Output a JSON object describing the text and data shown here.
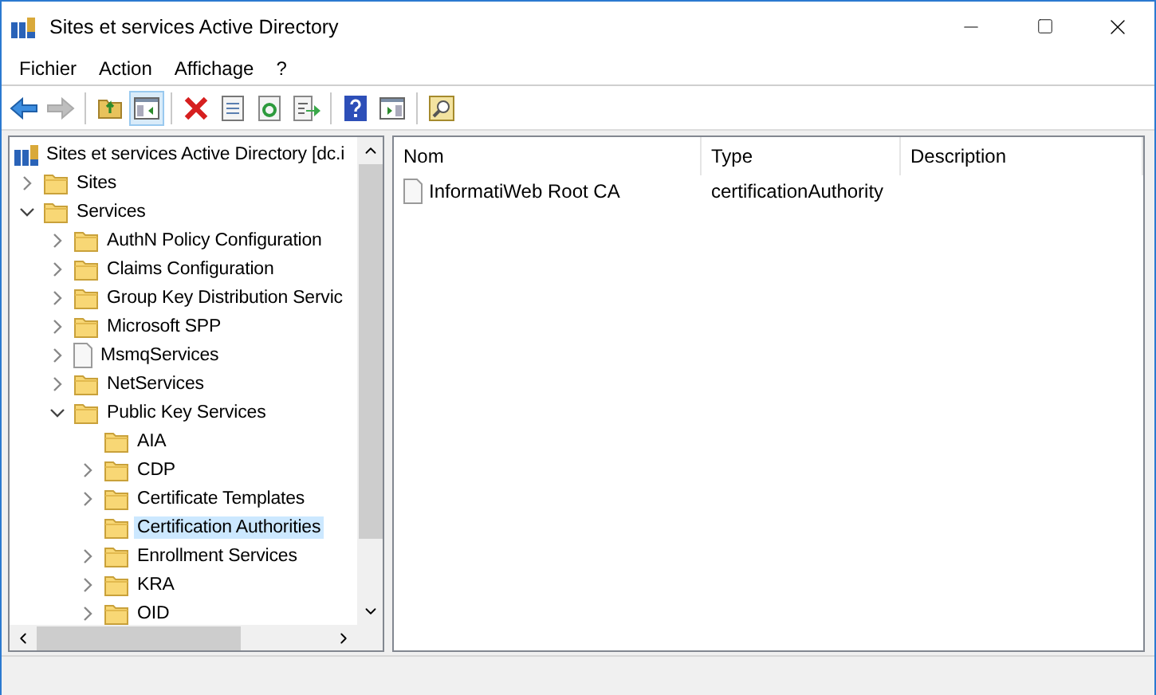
{
  "window": {
    "title": "Sites et services Active Directory"
  },
  "menu": [
    {
      "label": "Fichier"
    },
    {
      "label": "Action"
    },
    {
      "label": "Affichage"
    },
    {
      "label": "?"
    }
  ],
  "toolbar": [
    {
      "kind": "back",
      "disabled": false,
      "pressed": false
    },
    {
      "kind": "forward",
      "disabled": true,
      "pressed": false
    },
    {
      "kind": "separator"
    },
    {
      "kind": "up",
      "disabled": false,
      "pressed": false
    },
    {
      "kind": "console-tree",
      "disabled": false,
      "pressed": true
    },
    {
      "kind": "separator"
    },
    {
      "kind": "delete",
      "disabled": false,
      "pressed": false
    },
    {
      "kind": "properties",
      "disabled": false,
      "pressed": false
    },
    {
      "kind": "refresh",
      "disabled": false,
      "pressed": false
    },
    {
      "kind": "export",
      "disabled": false,
      "pressed": false
    },
    {
      "kind": "separator"
    },
    {
      "kind": "help",
      "disabled": false,
      "pressed": false
    },
    {
      "kind": "action-pane",
      "disabled": false,
      "pressed": false
    },
    {
      "kind": "separator"
    },
    {
      "kind": "find",
      "disabled": false,
      "pressed": false
    }
  ],
  "tree": {
    "root": {
      "label": "Sites et services Active Directory [dc.i",
      "selected": false
    },
    "items": [
      {
        "label": "Sites",
        "kind": "folder",
        "expandable": true,
        "expanded": false,
        "selected": false
      },
      {
        "label": "Services",
        "kind": "folder",
        "expandable": true,
        "expanded": true,
        "selected": false,
        "children": [
          {
            "label": "AuthN Policy Configuration",
            "kind": "folder",
            "expandable": true,
            "expanded": false,
            "selected": false
          },
          {
            "label": "Claims Configuration",
            "kind": "folder",
            "expandable": true,
            "expanded": false,
            "selected": false
          },
          {
            "label": "Group Key Distribution Servic",
            "kind": "folder",
            "expandable": true,
            "expanded": false,
            "selected": false
          },
          {
            "label": "Microsoft SPP",
            "kind": "folder",
            "expandable": true,
            "expanded": false,
            "selected": false
          },
          {
            "label": "MsmqServices",
            "kind": "file",
            "expandable": true,
            "expanded": false,
            "selected": false
          },
          {
            "label": "NetServices",
            "kind": "folder",
            "expandable": true,
            "expanded": false,
            "selected": false
          },
          {
            "label": "Public Key Services",
            "kind": "folder",
            "expandable": true,
            "expanded": true,
            "selected": false,
            "children": [
              {
                "label": "AIA",
                "kind": "folder",
                "expandable": false,
                "selected": false
              },
              {
                "label": "CDP",
                "kind": "folder",
                "expandable": true,
                "expanded": false,
                "selected": false
              },
              {
                "label": "Certificate Templates",
                "kind": "folder",
                "expandable": true,
                "expanded": false,
                "selected": false
              },
              {
                "label": "Certification Authorities",
                "kind": "folder",
                "expandable": false,
                "selected": true
              },
              {
                "label": "Enrollment Services",
                "kind": "folder",
                "expandable": true,
                "expanded": false,
                "selected": false
              },
              {
                "label": "KRA",
                "kind": "folder",
                "expandable": true,
                "expanded": false,
                "selected": false
              },
              {
                "label": "OID",
                "kind": "folder",
                "expandable": true,
                "expanded": false,
                "selected": false
              }
            ]
          }
        ]
      }
    ]
  },
  "list": {
    "columns": [
      "Nom",
      "Type",
      "Description"
    ],
    "rows": [
      {
        "kind": "file",
        "cells": [
          "InformatiWeb Root CA",
          "certificationAuthority"
        ]
      }
    ]
  }
}
